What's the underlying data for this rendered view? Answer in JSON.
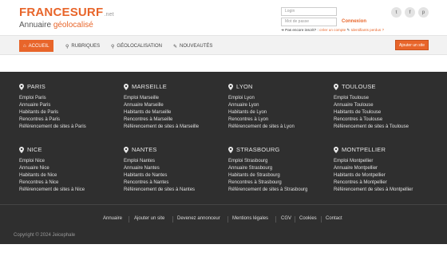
{
  "brand": {
    "name": "FRANCESURF",
    "tld": ".net",
    "subtitle_prefix": "Annuaire",
    "subtitle_highlight": "géolocalisé"
  },
  "login": {
    "login_placeholder": "Login",
    "password_placeholder": "Mot de passe",
    "connexion_label": "Connexion",
    "not_registered": "Pas encore inscrit? :",
    "create_account": "créer un compte",
    "forgot_ids": "Identifiants perdus ?"
  },
  "socials": [
    "twitter",
    "facebook",
    "pinterest"
  ],
  "nav": {
    "items": [
      {
        "label": "ACCUEIL",
        "icon": "home-icon"
      },
      {
        "label": "RUBRIQUES",
        "icon": "search-icon"
      },
      {
        "label": "GÉOLOCALISATION",
        "icon": "pin-icon"
      },
      {
        "label": "NOUVEAUTÉS",
        "icon": "pencil-icon"
      }
    ],
    "add_site_label": "Ajouter un site"
  },
  "cities": [
    {
      "name": "PARIS",
      "links": [
        "Emploi Paris",
        "Annuaire Paris",
        "Habitants de Paris",
        "Rencontres à Paris",
        "Référencement de sites à Paris"
      ]
    },
    {
      "name": "MARSEILLE",
      "links": [
        "Emploi Marseille",
        "Annuaire Marseille",
        "Habitants de Marseille",
        "Rencontres à Marseille",
        "Référencement de sites à Marseille"
      ]
    },
    {
      "name": "LYON",
      "links": [
        "Emploi Lyon",
        "Annuaire Lyon",
        "Habitants de Lyon",
        "Rencontres à Lyon",
        "Référencement de sites à Lyon"
      ]
    },
    {
      "name": "TOULOUSE",
      "links": [
        "Emploi Toulouse",
        "Annuaire Toulouse",
        "Habitants de Toulouse",
        "Rencontres à Toulouse",
        "Référencement de sites à Toulouse"
      ]
    },
    {
      "name": "NICE",
      "links": [
        "Emploi Nice",
        "Annuaire Nice",
        "Habitants de Nice",
        "Rencontres à Nice",
        "Référencement de sites à Nice"
      ]
    },
    {
      "name": "NANTES",
      "links": [
        "Emploi Nantes",
        "Annuaire Nantes",
        "Habitants de Nantes",
        "Rencontres à Nantes",
        "Référencement de sites à Nantes"
      ]
    },
    {
      "name": "STRASBOURG",
      "links": [
        "Emploi Strasbourg",
        "Annuaire Strasbourg",
        "Habitants de Strasbourg",
        "Rencontres à Strasbourg",
        "Référencement de sites à Strasbourg"
      ]
    },
    {
      "name": "MONTPELLIER",
      "links": [
        "Emploi Montpellier",
        "Annuaire Montpellier",
        "Habitants de Montpellier",
        "Rencontres à Montpellier",
        "Référencement de sites à Montpellier"
      ]
    }
  ],
  "footer_links": [
    "Annuaire",
    "Ajouter un site",
    "Devenez annonceur",
    "Mentions légales",
    "CGV",
    "Cookies",
    "Contact"
  ],
  "copyright": "Copyright © 2024 Jeicephale",
  "colors": {
    "accent": "#e8652a",
    "dark_bg": "#2f2f2f"
  }
}
